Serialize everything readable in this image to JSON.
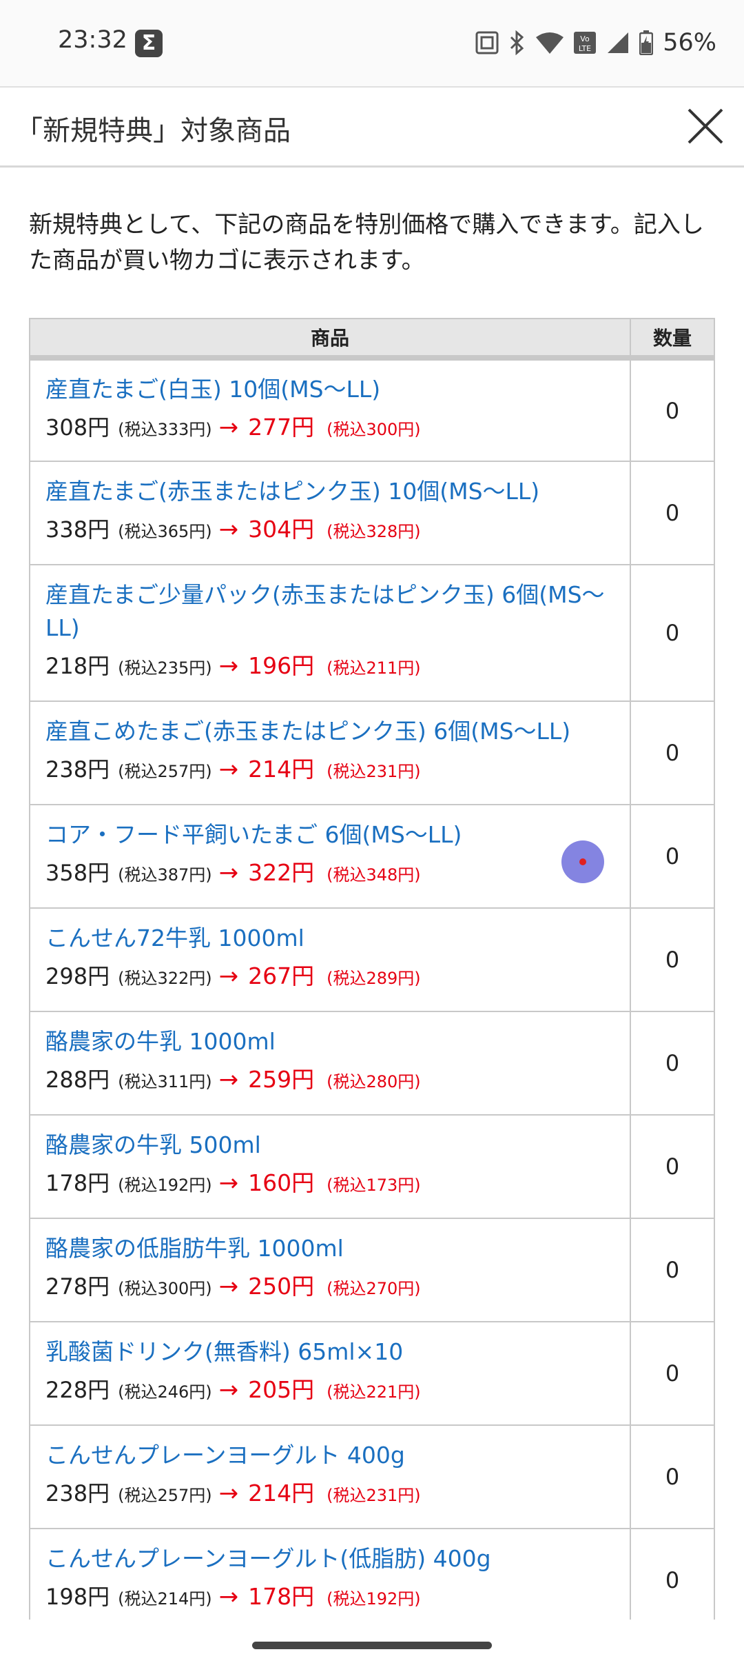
{
  "status_bar": {
    "time": "23:32",
    "sigma_icon": "Σ",
    "battery_percent": "56%"
  },
  "header": {
    "title": "「新規特典」対象商品",
    "close_icon": "close-icon"
  },
  "intro_text": "新規特典として、下記の商品を特別価格で購入できます。記入した商品が買い物カゴに表示されます。",
  "table": {
    "headers": {
      "product": "商品",
      "quantity": "数量"
    },
    "arrow": "→",
    "rows": [
      {
        "name": "産直たまご(白玉) 10個(MS〜LL)",
        "orig": "308円",
        "orig_tax": "(税込333円)",
        "sale": "277円",
        "sale_tax": "(税込300円)",
        "qty": "0"
      },
      {
        "name": "産直たまご(赤玉またはピンク玉) 10個(MS〜LL)",
        "orig": "338円",
        "orig_tax": "(税込365円)",
        "sale": "304円",
        "sale_tax": "(税込328円)",
        "qty": "0"
      },
      {
        "name": "産直たまご少量パック(赤玉またはピンク玉) 6個(MS〜LL)",
        "orig": "218円",
        "orig_tax": "(税込235円)",
        "sale": "196円",
        "sale_tax": "(税込211円)",
        "qty": "0"
      },
      {
        "name": "産直こめたまご(赤玉またはピンク玉) 6個(MS〜LL)",
        "orig": "238円",
        "orig_tax": "(税込257円)",
        "sale": "214円",
        "sale_tax": "(税込231円)",
        "qty": "0"
      },
      {
        "name": "コア・フード平飼いたまご 6個(MS〜LL)",
        "orig": "358円",
        "orig_tax": "(税込387円)",
        "sale": "322円",
        "sale_tax": "(税込348円)",
        "qty": "0"
      },
      {
        "name": "こんせん72牛乳 1000ml",
        "orig": "298円",
        "orig_tax": "(税込322円)",
        "sale": "267円",
        "sale_tax": "(税込289円)",
        "qty": "0"
      },
      {
        "name": "酪農家の牛乳 1000ml",
        "orig": "288円",
        "orig_tax": "(税込311円)",
        "sale": "259円",
        "sale_tax": "(税込280円)",
        "qty": "0"
      },
      {
        "name": "酪農家の牛乳 500ml",
        "orig": "178円",
        "orig_tax": "(税込192円)",
        "sale": "160円",
        "sale_tax": "(税込173円)",
        "qty": "0"
      },
      {
        "name": "酪農家の低脂肪牛乳 1000ml",
        "orig": "278円",
        "orig_tax": "(税込300円)",
        "sale": "250円",
        "sale_tax": "(税込270円)",
        "qty": "0"
      },
      {
        "name": "乳酸菌ドリンク(無香料) 65ml×10",
        "orig": "228円",
        "orig_tax": "(税込246円)",
        "sale": "205円",
        "sale_tax": "(税込221円)",
        "qty": "0"
      },
      {
        "name": "こんせんプレーンヨーグルト 400g",
        "orig": "238円",
        "orig_tax": "(税込257円)",
        "sale": "214円",
        "sale_tax": "(税込231円)",
        "qty": "0"
      },
      {
        "name": "こんせんプレーンヨーグルト(低脂肪) 400g",
        "orig": "198円",
        "orig_tax": "(税込214円)",
        "sale": "178円",
        "sale_tax": "(税込192円)",
        "qty": "0"
      }
    ]
  },
  "colors": {
    "link": "#1a6fc0",
    "sale": "#e60012",
    "header_bg": "#e6e6e6"
  }
}
